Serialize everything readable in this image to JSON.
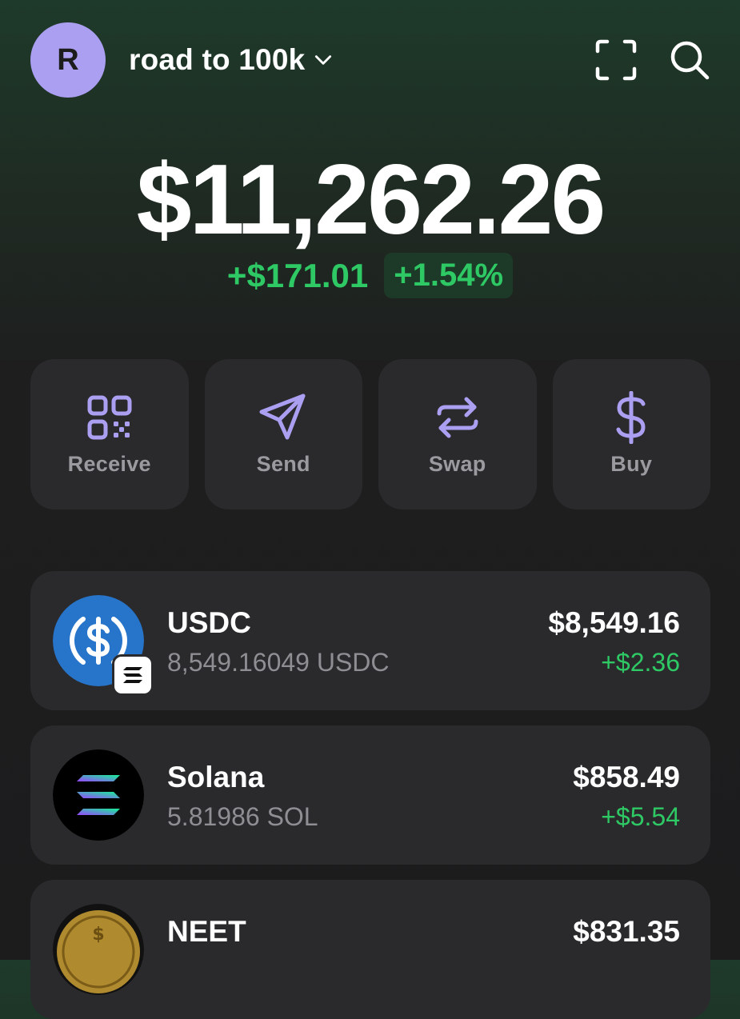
{
  "header": {
    "avatar_letter": "R",
    "account_name": "road to 100k",
    "icons": [
      "chevron-down-icon",
      "scan-icon",
      "search-icon"
    ]
  },
  "portfolio": {
    "balance": "$11,262.26",
    "change_abs": "+$171.01",
    "change_pct": "+1.54%"
  },
  "actions": [
    {
      "label": "Receive",
      "icon": "qr-code-icon"
    },
    {
      "label": "Send",
      "icon": "paper-plane-icon"
    },
    {
      "label": "Swap",
      "icon": "swap-arrows-icon"
    },
    {
      "label": "Buy",
      "icon": "dollar-icon"
    }
  ],
  "tokens": [
    {
      "name": "USDC",
      "quantity": "8,549.16049 USDC",
      "value": "$8,549.16",
      "change": "+$2.36"
    },
    {
      "name": "Solana",
      "quantity": "5.81986 SOL",
      "value": "$858.49",
      "change": "+$5.54"
    },
    {
      "name": "NEET",
      "quantity": "",
      "value": "$831.35",
      "change": ""
    }
  ],
  "colors": {
    "accent_purple": "#ab9ff2",
    "positive_green": "#2ec965",
    "card_bg": "#2a2a2d",
    "usdc_blue": "#2775ca"
  }
}
